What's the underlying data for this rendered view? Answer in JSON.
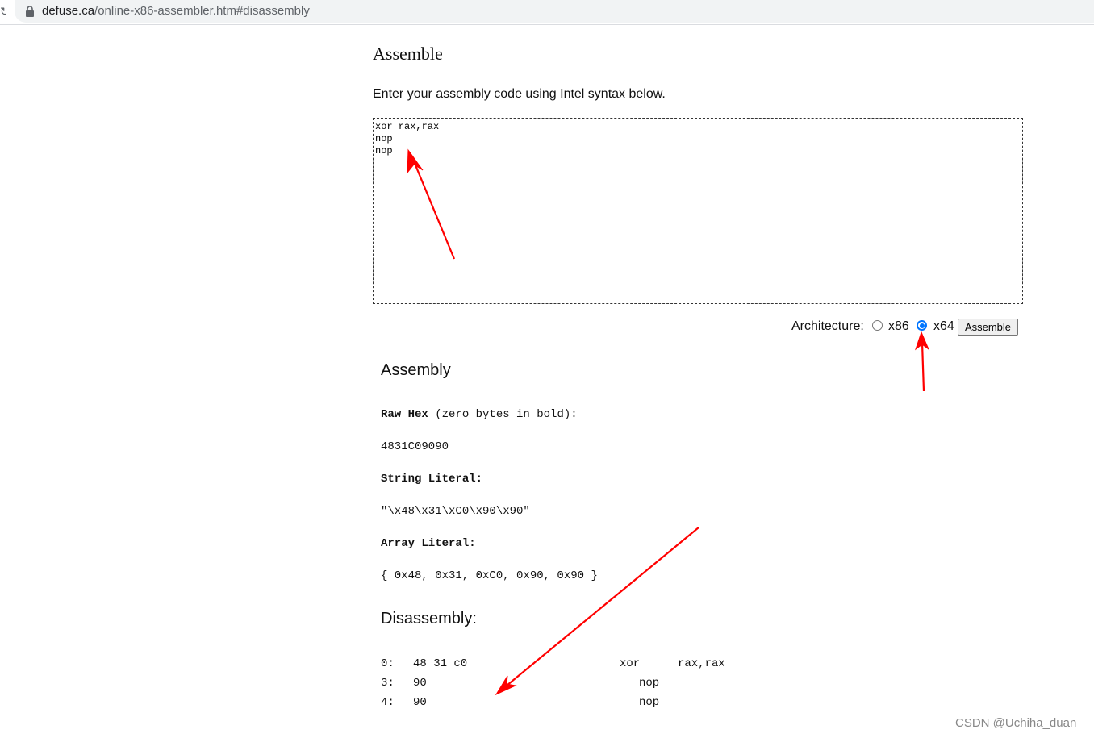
{
  "browser": {
    "url_host": "defuse.ca",
    "url_path": "/online-x86-assembler.htm#disassembly"
  },
  "page": {
    "title": "Assemble",
    "instructions": "Enter your assembly code using Intel syntax below.",
    "code": "xor rax,rax\nnop\nnop",
    "architecture_label": "Architecture:",
    "arch_options": [
      {
        "label": "x86",
        "checked": false
      },
      {
        "label": "x64",
        "checked": true
      }
    ],
    "assemble_button": "Assemble"
  },
  "assembly": {
    "heading": "Assembly",
    "raw_hex_label": "Raw Hex",
    "raw_hex_note": " (zero bytes in bold):",
    "raw_hex_value": "4831C09090",
    "string_literal_label": "String Literal:",
    "string_literal_value": "\"\\x48\\x31\\xC0\\x90\\x90\"",
    "array_literal_label": "Array Literal:",
    "array_literal_value": "{ 0x48, 0x31, 0xC0, 0x90, 0x90 }"
  },
  "disassembly": {
    "heading": "Disassembly:",
    "lines": [
      {
        "offset": "0:",
        "bytes": "48 31 c0",
        "mnemonic": "xor",
        "operands": "rax,rax"
      },
      {
        "offset": "3:",
        "bytes": "90",
        "mnemonic": "nop",
        "operands": ""
      },
      {
        "offset": "4:",
        "bytes": "90",
        "mnemonic": "nop",
        "operands": ""
      }
    ]
  },
  "watermark": "CSDN @Uchiha_duan",
  "colors": {
    "annotation_arrow": "#ff0000",
    "radio_selected": "#0075ff",
    "urlbar_bg": "#f1f3f4"
  }
}
